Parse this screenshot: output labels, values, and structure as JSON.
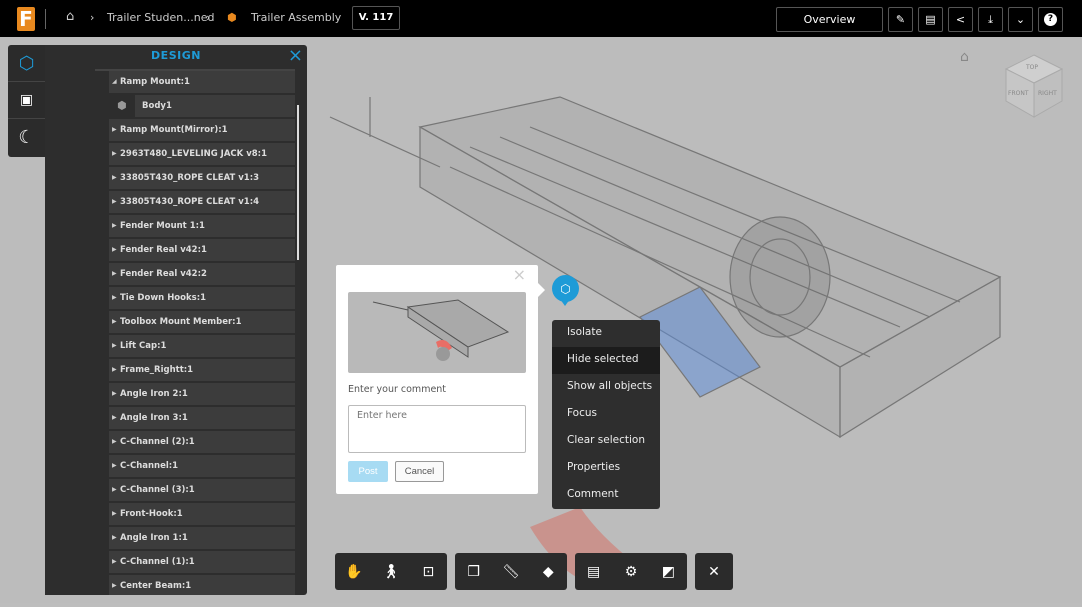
{
  "topbar": {
    "logo": "F",
    "breadcrumb": [
      "Trailer Studen...ned",
      "Trailer Assembly"
    ],
    "version": "V. 117",
    "overview_label": "Overview",
    "icons": [
      "home-icon",
      "pencil-icon",
      "comment-icon",
      "share-icon",
      "download-icon",
      "chevron-down-icon",
      "help-icon"
    ]
  },
  "viewcube": {
    "top": "TOP",
    "front": "FRONT",
    "right": "RIGHT"
  },
  "panel": {
    "title": "DESIGN",
    "items": [
      {
        "label": "Ramp Mount:1",
        "expanded": true
      },
      {
        "label": "Body1",
        "child": true
      },
      {
        "label": "Ramp Mount(Mirror):1"
      },
      {
        "label": "2963T480_LEVELING JACK v8:1"
      },
      {
        "label": "33805T430_ROPE CLEAT v1:3"
      },
      {
        "label": "33805T430_ROPE CLEAT v1:4"
      },
      {
        "label": "Fender Mount 1:1"
      },
      {
        "label": "Fender Real v42:1"
      },
      {
        "label": "Fender Real v42:2"
      },
      {
        "label": "Tie Down Hooks:1"
      },
      {
        "label": "Toolbox Mount Member:1"
      },
      {
        "label": "Lift Cap:1"
      },
      {
        "label": "Frame_Rightt:1"
      },
      {
        "label": "Angle Iron 2:1"
      },
      {
        "label": "Angle Iron 3:1"
      },
      {
        "label": "C-Channel (2):1"
      },
      {
        "label": "C-Channel:1"
      },
      {
        "label": "C-Channel (3):1"
      },
      {
        "label": "Front-Hook:1"
      },
      {
        "label": "Angle Iron 1:1"
      },
      {
        "label": "C-Channel (1):1"
      },
      {
        "label": "Center Beam:1"
      }
    ]
  },
  "comment": {
    "label": "Enter your comment",
    "placeholder": "Enter here",
    "post": "Post",
    "cancel": "Cancel"
  },
  "context_menu": {
    "items": [
      "Isolate",
      "Hide selected",
      "Show all objects",
      "Focus",
      "Clear selection",
      "Properties",
      "Comment"
    ],
    "highlighted": "Hide selected"
  },
  "toolbar": {
    "groups": [
      [
        "pan-icon",
        "walk-icon",
        "fit-zoom-icon"
      ],
      [
        "explode-icon",
        "measure-icon",
        "section-icon"
      ],
      [
        "model-browser-icon",
        "settings-icon",
        "fullscreen-icon"
      ],
      [
        "close-icon"
      ]
    ]
  },
  "colors": {
    "accent": "#1e9bd7",
    "brand": "#e8891f"
  }
}
